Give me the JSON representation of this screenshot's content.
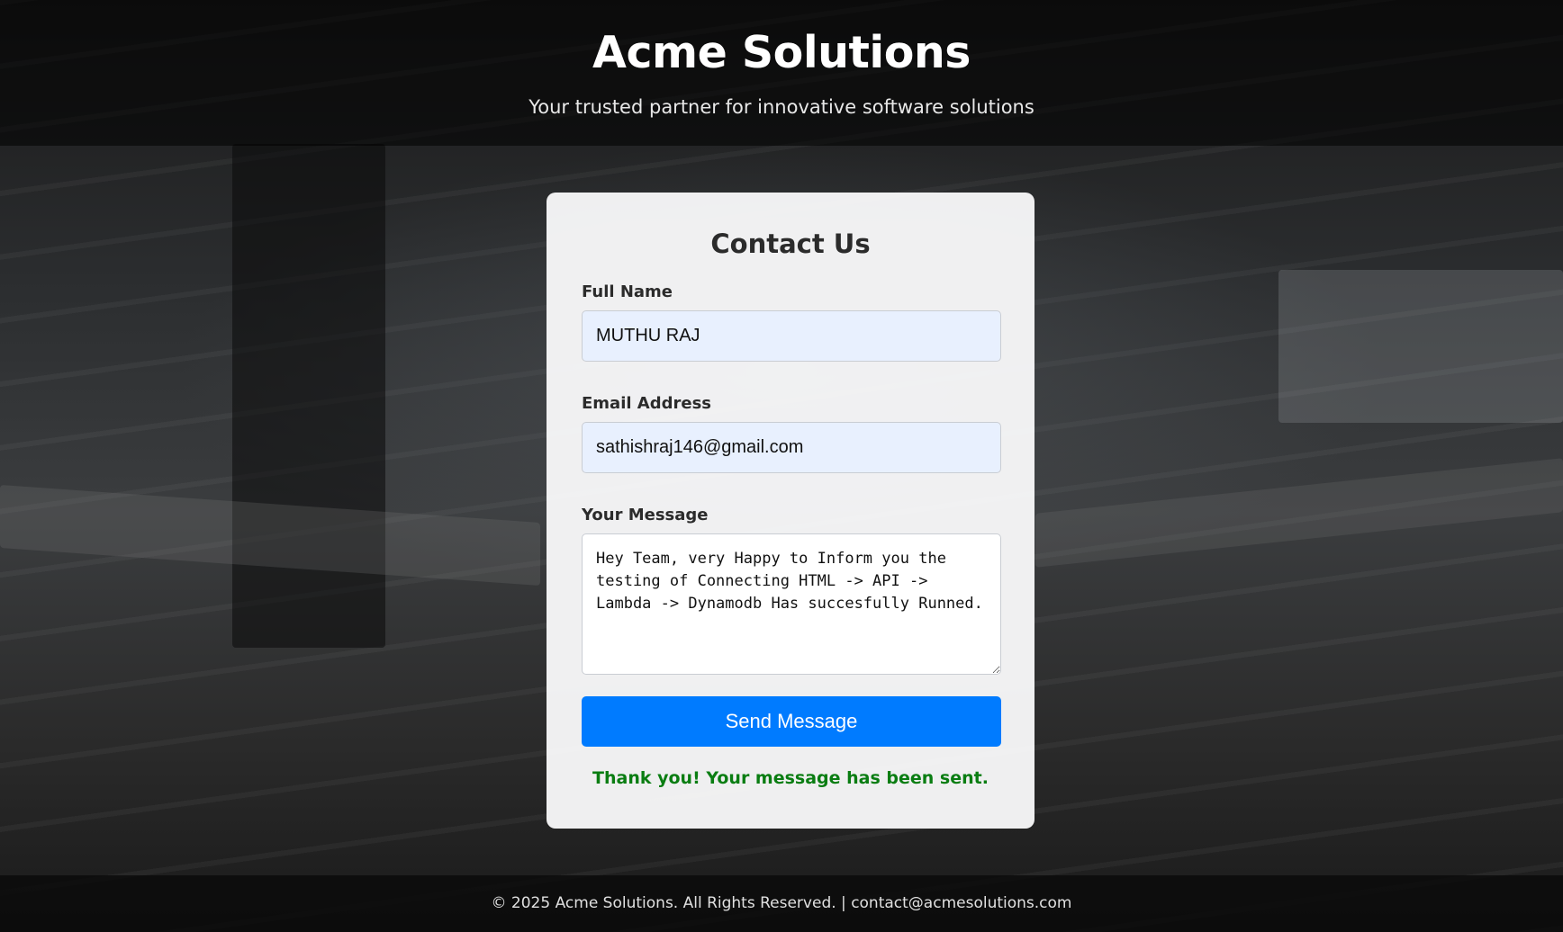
{
  "header": {
    "title": "Acme Solutions",
    "tagline": "Your trusted partner for innovative software solutions"
  },
  "contact_form": {
    "title": "Contact Us",
    "name_label": "Full Name",
    "name_value": "MUTHU RAJ",
    "email_label": "Email Address",
    "email_value": "sathishraj146@gmail.com",
    "message_label": "Your Message",
    "message_value": "Hey Team, very Happy to Inform you the testing of Connecting HTML -> API -> Lambda -> Dynamodb Has succesfully Runned.",
    "submit_label": "Send Message",
    "status_text": "Thank you! Your message has been sent."
  },
  "footer": {
    "copyright": "© 2025 Acme Solutions. All Rights Reserved. | ",
    "email": "contact@acmesolutions.com"
  },
  "colors": {
    "button": "#007bff",
    "success": "#0a7d12",
    "input_autofill": "#e8f0fe"
  }
}
